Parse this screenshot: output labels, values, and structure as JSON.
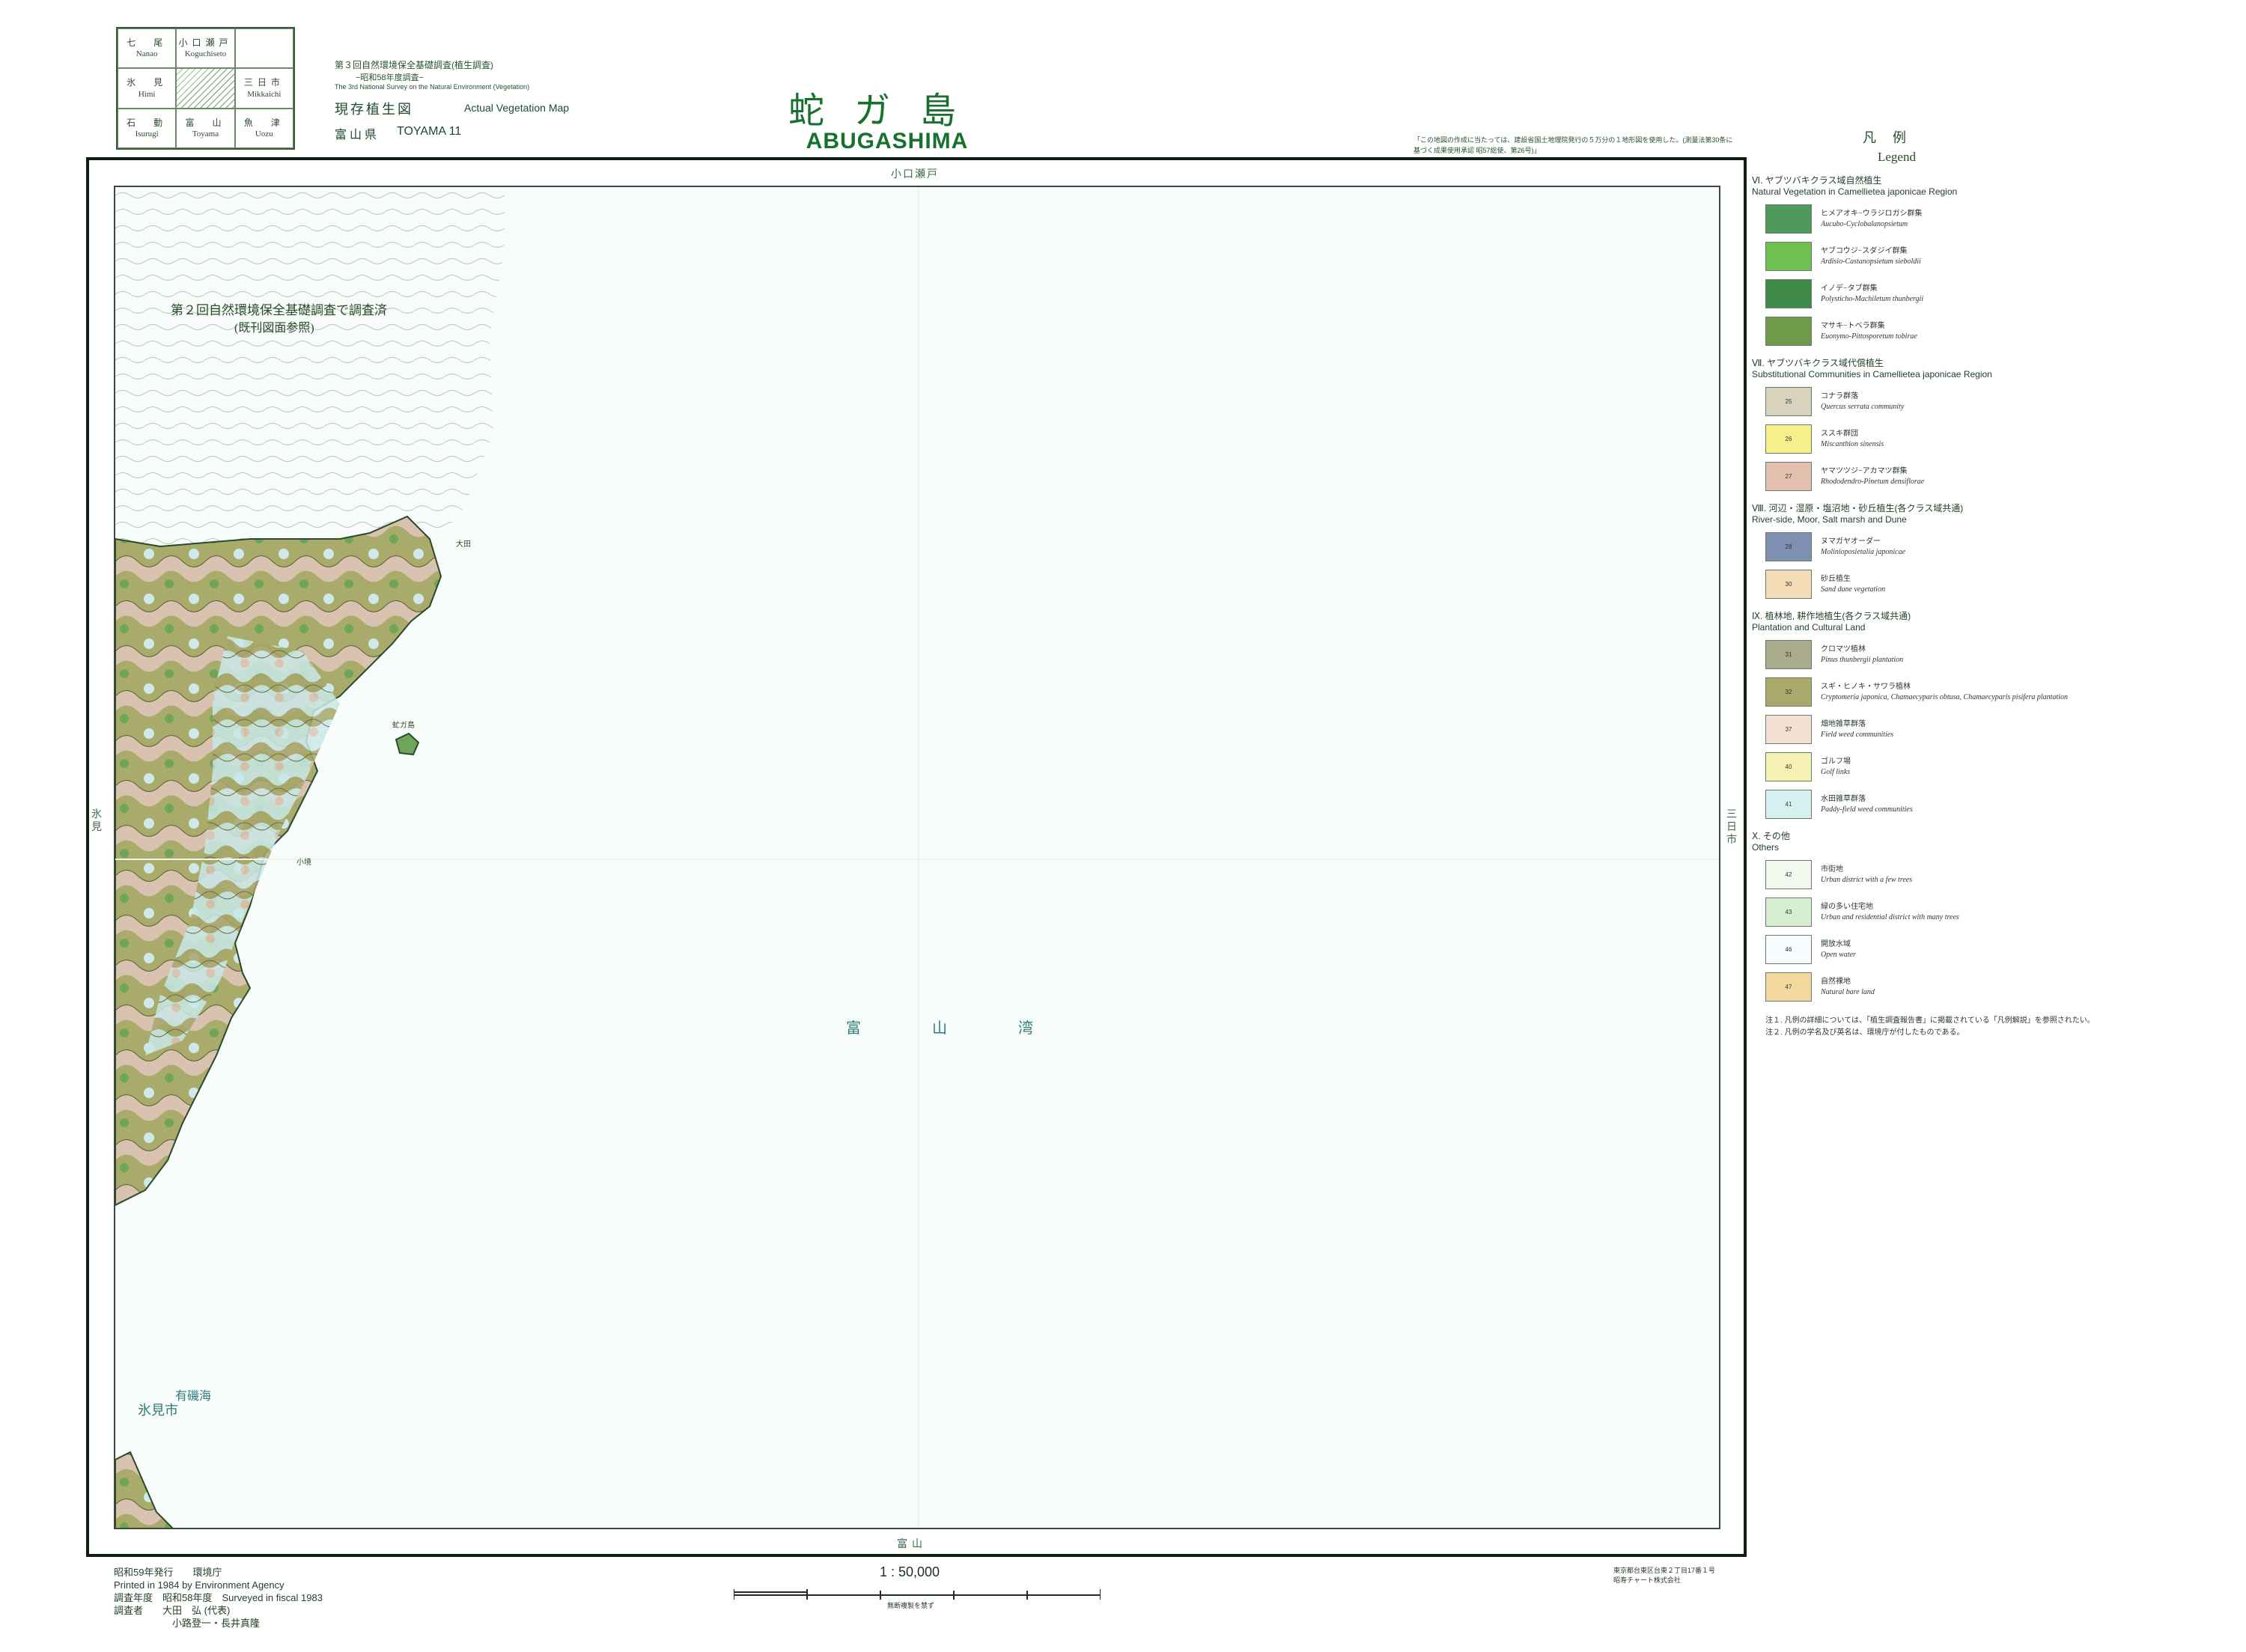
{
  "index_map": [
    {
      "jp": "七　尾",
      "en": "Nanao"
    },
    {
      "jp": "小口瀬戸",
      "en": "Koguchiseto"
    },
    {
      "jp": "",
      "en": ""
    },
    {
      "jp": "氷　見",
      "en": "Himi"
    },
    {
      "jp": "",
      "en": ""
    },
    {
      "jp": "三日市",
      "en": "Mikkaichi"
    },
    {
      "jp": "石　動",
      "en": "Isurugi"
    },
    {
      "jp": "富　山",
      "en": "Toyama"
    },
    {
      "jp": "魚　津",
      "en": "Uozu"
    }
  ],
  "header": {
    "survey_title": "第３回自然環境保全基礎調査(植生調査)",
    "survey_sub": "−昭和58年度調査−",
    "survey_en": "The 3rd National Survey on the Natural Environment (Vegetation)",
    "map_type_jp": "現存植生図",
    "map_type_en": "Actual Vegetation Map",
    "prefecture_jp": "富山県",
    "sheet_en": "TOYAMA 11",
    "sheet_title_jp": "蛇ガ島",
    "sheet_title_en": "ABUGASHIMA",
    "copyright_note": "「この地図の作成に当たっては、建設省国土地理院発行の５万分の１地形図を使用した。(測量法第30条に基づく成果使用承認 昭57総使、第26号)」"
  },
  "map": {
    "edge_top": "小口瀬戸",
    "edge_bottom": "富山",
    "edge_left": "氷見",
    "edge_right": "三日市",
    "bay_label": "富山湾",
    "surveyed_note_1": "第２回自然環境保全基礎調査で調査済",
    "surveyed_note_2": "(既刊図面参照)",
    "place_labels": [
      "氷見市",
      "有磯海",
      "虻ガ島",
      "大田",
      "小境"
    ]
  },
  "legend": {
    "title_jp": "凡例",
    "title_en": "Legend",
    "groups": [
      {
        "jp": "Ⅵ. ヤブツバキクラス域自然植生",
        "en": "Natural Vegetation in Camellietea japonicae Region",
        "items": [
          {
            "code": "",
            "jp": "ヒメアオキ−ウラジロガシ群集",
            "en": "Aucubo-Cyclobalanopsietum",
            "color": "#4f9a5a"
          },
          {
            "code": "",
            "jp": "ヤブコウジ−スダジイ群集",
            "en": "Ardisio-Castanopsietum sieboldii",
            "color": "#6fc04e"
          },
          {
            "code": "",
            "jp": "イノデ−タブ群集",
            "en": "Polysticho-Machiletum thunbergii",
            "color": "#3f8a48"
          },
          {
            "code": "",
            "jp": "マサキ−トベラ群集",
            "en": "Euonymo-Pittosporetum tobirae",
            "color": "#6f9a4a"
          }
        ]
      },
      {
        "jp": "Ⅶ. ヤブツバキクラス域代償植生",
        "en": "Substitutional Communities in Camellietea japonicae Region",
        "items": [
          {
            "code": "25",
            "jp": "コナラ群落",
            "en": "Quercus serrata community",
            "color": "#d8d3bd"
          },
          {
            "code": "26",
            "jp": "ススキ群団",
            "en": "Miscanthion sinensis",
            "color": "#f6f08a"
          },
          {
            "code": "27",
            "jp": "ヤマツツジ−アカマツ群集",
            "en": "Rhododendro-Pinetum densiflorae",
            "color": "#e3c0ae"
          }
        ]
      },
      {
        "jp": "Ⅷ. 河辺・湿原・塩沼地・砂丘植生(各クラス域共通)",
        "en": "River-side, Moor, Salt marsh and Dune",
        "items": [
          {
            "code": "28",
            "jp": "ヌマガヤオーダー",
            "en": "Molinioposietalia japonicae",
            "color": "#7f8fb2"
          },
          {
            "code": "30",
            "jp": "砂丘植生",
            "en": "Sand dune vegetation",
            "color": "#f3dcb6"
          }
        ]
      },
      {
        "jp": "Ⅸ. 植林地, 耕作地植生(各クラス域共通)",
        "en": "Plantation and Cultural Land",
        "items": [
          {
            "code": "31",
            "jp": "クロマツ植林",
            "en": "Pinus thunbergii plantation",
            "color": "#a9ab8a"
          },
          {
            "code": "32",
            "jp": "スギ・ヒノキ・サワラ植林",
            "en": "Cryptomeria japonica, Chamaecyparis obtusa, Chamaecyparis pisifera plantation",
            "color": "#aaa86a"
          },
          {
            "code": "37",
            "jp": "畑地雑草群落",
            "en": "Field weed communities",
            "color": "#f3e2d4"
          },
          {
            "code": "40",
            "jp": "ゴルフ場",
            "en": "Golf links",
            "color": "#f6f2b4"
          },
          {
            "code": "41",
            "jp": "水田雑草群落",
            "en": "Paddy-field weed communities",
            "color": "#d6f0f0"
          }
        ]
      },
      {
        "jp": "Ⅹ. その他",
        "en": "Others",
        "items": [
          {
            "code": "42",
            "jp": "市街地",
            "en": "Urban district with a few trees",
            "color": "#f2f8ee"
          },
          {
            "code": "43",
            "jp": "緑の多い住宅地",
            "en": "Urban and residential district with many trees",
            "color": "#d6efd0"
          },
          {
            "code": "46",
            "jp": "開放水域",
            "en": "Open water",
            "color": "#f8fbff"
          },
          {
            "code": "47",
            "jp": "自然裸地",
            "en": "Natural bare land",
            "color": "#f3d8a0"
          }
        ]
      }
    ],
    "notes": [
      "注１. 凡例の詳細については、「植生調査報告書」に掲載されている「凡例解説」を参照されたい。",
      "注２. 凡例の学名及び英名は、環境庁が付したものである。"
    ]
  },
  "footer": {
    "published_jp": "昭和59年発行",
    "agency_jp": "環境庁",
    "printed_en": "Printed in 1984 by Environment Agency",
    "survey_year_label": "調査年度",
    "survey_year": "昭和58年度",
    "surveyed_en": "Surveyed in fiscal 1983",
    "investigators_label": "調査者",
    "investigators_1": "大田　弘 (代表)",
    "investigators_2": "小路登一・長井真隆",
    "scale": "1 : 50,000",
    "scale_caption": "無断複製を禁ず",
    "printer_1": "東京都台東区台東２丁目17番１号",
    "printer_2": "昭寿チャート株式会社"
  }
}
